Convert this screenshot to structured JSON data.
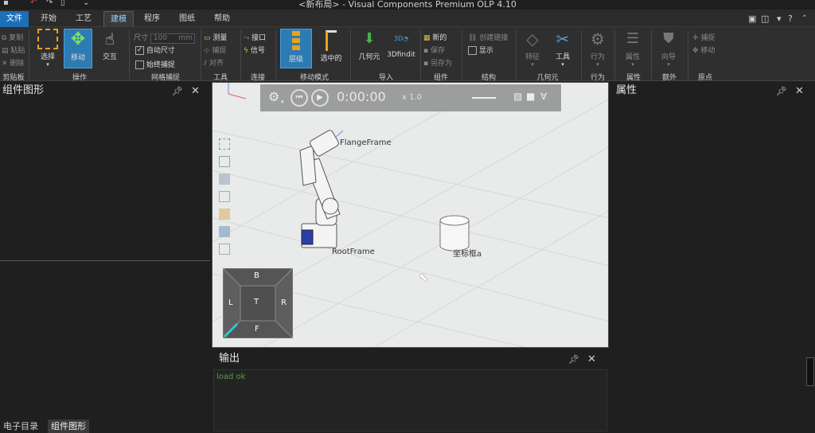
{
  "window": {
    "title": "<新布局> - Visual Components Premium OLP 4.10"
  },
  "menu": {
    "tabs": [
      "文件",
      "开始",
      "工艺",
      "建模",
      "程序",
      "图纸",
      "帮助"
    ],
    "active_tab": "建模"
  },
  "ribbon": {
    "clipboard": {
      "label": "剪贴板",
      "copy": "复制",
      "paste": "粘贴",
      "delete": "删除"
    },
    "operate": {
      "label": "操作",
      "select": "选择",
      "move": "移动",
      "interact": "交互"
    },
    "grid_snap": {
      "label": "网格捕捉",
      "size_label": "尺寸",
      "size_value": "100",
      "size_unit": "mm",
      "auto_size": "自动尺寸",
      "always_snap": "始终捕捉"
    },
    "tools": {
      "label": "工具",
      "measure": "测量",
      "capture": "捕捉",
      "align": "对齐"
    },
    "connect": {
      "label": "连接",
      "interface": "接口",
      "signal": "信号"
    },
    "move_mode": {
      "label": "移动模式",
      "hierarchy": "层级",
      "selected": "选中的"
    },
    "import": {
      "label": "导入",
      "geometry": "几何元",
      "3dfindit": "3Dfindit"
    },
    "component": {
      "label": "组件",
      "new": "新的",
      "save": "保存",
      "save_as": "另存为"
    },
    "structure": {
      "label": "结构",
      "create_link": "创建链接",
      "show": "显示"
    },
    "geometry": {
      "label": "几何元",
      "feature": "特征",
      "tools": "工具"
    },
    "behavior": {
      "label": "行为",
      "behavior": "行为"
    },
    "properties": {
      "label": "属性",
      "props": "属性"
    },
    "extra": {
      "label": "额外",
      "wizard": "向导"
    },
    "origin": {
      "label": "原点",
      "capture": "捕捉",
      "move": "移动"
    }
  },
  "left_panel": {
    "title": "组件图形"
  },
  "right_panel": {
    "title": "属性"
  },
  "viewport": {
    "time": "0:00:00",
    "speed": "x 1.0",
    "labels": {
      "flange": "FlangeFrame",
      "root": "RootFrame",
      "frame": "坐标框a"
    },
    "navcube": {
      "top": "B",
      "center": "T",
      "left": "L",
      "right": "R",
      "bottom": "F"
    }
  },
  "output": {
    "title": "输出",
    "log": "load ok"
  },
  "bottom_tabs": [
    "电子目录",
    "组件图形"
  ],
  "colors": {
    "accent": "#1c6fb8",
    "active_button": "#2d7bb3",
    "log_text": "#5c9b4e",
    "viewport_bg": "#e9eaea"
  }
}
